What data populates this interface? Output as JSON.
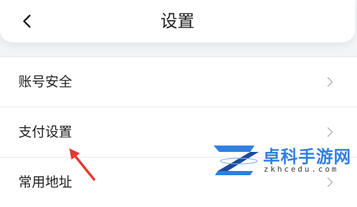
{
  "header": {
    "title": "设置",
    "back_icon": "chevron-left-icon"
  },
  "settings": {
    "items": [
      {
        "label": "账号安全",
        "icon": "chevron-right-icon"
      },
      {
        "label": "支付设置",
        "icon": "chevron-right-icon"
      },
      {
        "label": "常用地址",
        "icon": "chevron-right-icon"
      }
    ]
  },
  "annotation": {
    "icon": "red-arrow-icon",
    "color": "#e53935"
  },
  "watermark": {
    "name": "卓科手游网",
    "url": "zkhcedu.com",
    "colors": {
      "primary": "#2f7fe0",
      "dark": "#1a4a9c"
    }
  }
}
